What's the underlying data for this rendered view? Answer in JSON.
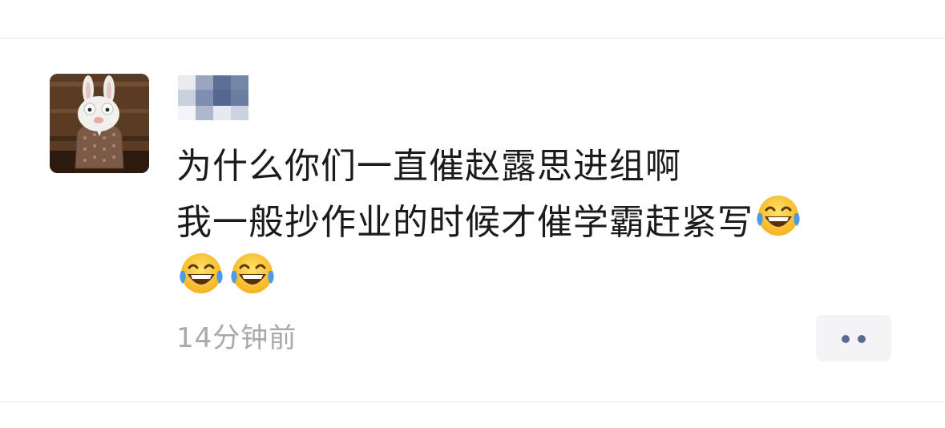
{
  "post": {
    "line1": "为什么你们一直催赵露思进组啊",
    "line2": "我一般抄作业的时候才催学霸赶紧写",
    "emoji_name": "tears-of-joy-emoji",
    "trailing_emoji_count": 2,
    "timestamp": "14分钟前"
  },
  "author": {
    "avatar_icon": "rabbid-bunny-avatar",
    "nickname_state": "pixelated"
  },
  "actions": {
    "more_icon": "more-dots-icon"
  },
  "colors": {
    "text": "#1b1b1b",
    "timestamp": "#a8a8a8",
    "divider": "#e6e6e6",
    "more_button_bg": "#f4f4f6",
    "more_dots": "#5b6a91"
  }
}
